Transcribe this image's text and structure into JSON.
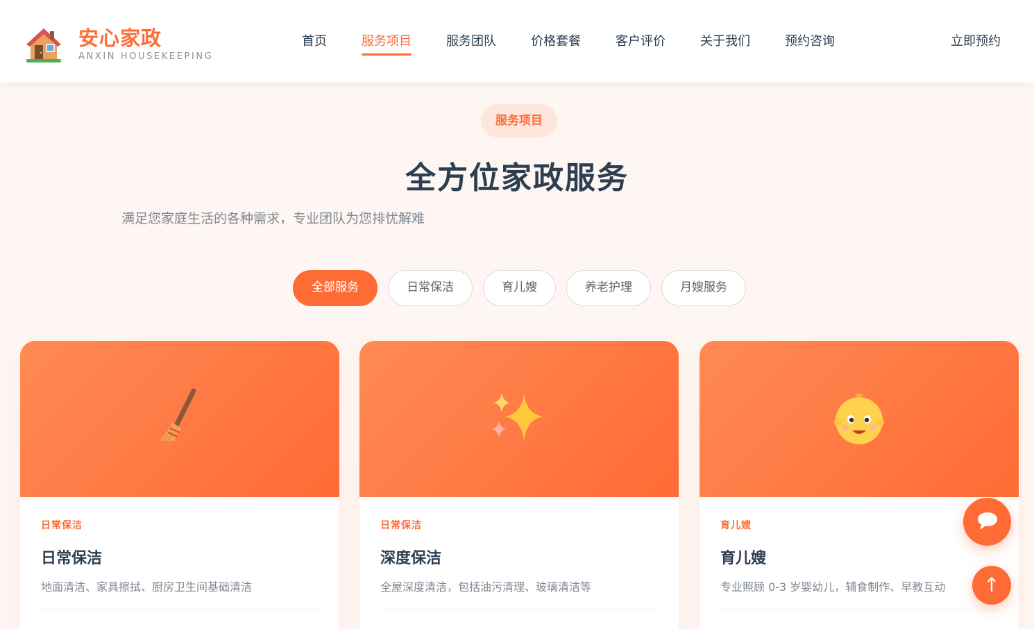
{
  "brand": {
    "name": "安心家政",
    "subtitle": "ANXIN HOUSEKEEPING",
    "icon": "house-icon",
    "accent": "#ff6b35"
  },
  "nav": {
    "items": [
      {
        "label": "首页"
      },
      {
        "label": "服务项目",
        "active": true
      },
      {
        "label": "服务团队"
      },
      {
        "label": "价格套餐"
      },
      {
        "label": "客户评价"
      },
      {
        "label": "关于我们"
      },
      {
        "label": "预约咨询"
      }
    ],
    "cta": "立即预约"
  },
  "section": {
    "tag": "服务项目",
    "title": "全方位家政服务",
    "subtitle": "满足您家庭生活的各种需求，专业团队为您排忧解难"
  },
  "filters": {
    "items": [
      {
        "label": "全部服务",
        "active": true
      },
      {
        "label": "日常保洁"
      },
      {
        "label": "育儿嫂"
      },
      {
        "label": "养老护理"
      },
      {
        "label": "月嫂服务"
      }
    ]
  },
  "cards": [
    {
      "icon": "broom-icon",
      "category": "日常保洁",
      "title": "日常保洁",
      "description": "地面清洁、家具擦拭、厨房卫生间基础清洁"
    },
    {
      "icon": "sparkles-icon",
      "category": "日常保洁",
      "title": "深度保洁",
      "description": "全屋深度清洁，包括油污清理、玻璃清洁等"
    },
    {
      "icon": "baby-icon",
      "category": "育儿嫂",
      "title": "育儿嫂",
      "description": "专业照顾 0-3 岁婴幼儿，辅食制作、早教互动"
    }
  ],
  "floating": {
    "chat_icon": "chat-bubble-icon",
    "top_icon": "arrow-up-icon",
    "top_glyph": "↑"
  }
}
